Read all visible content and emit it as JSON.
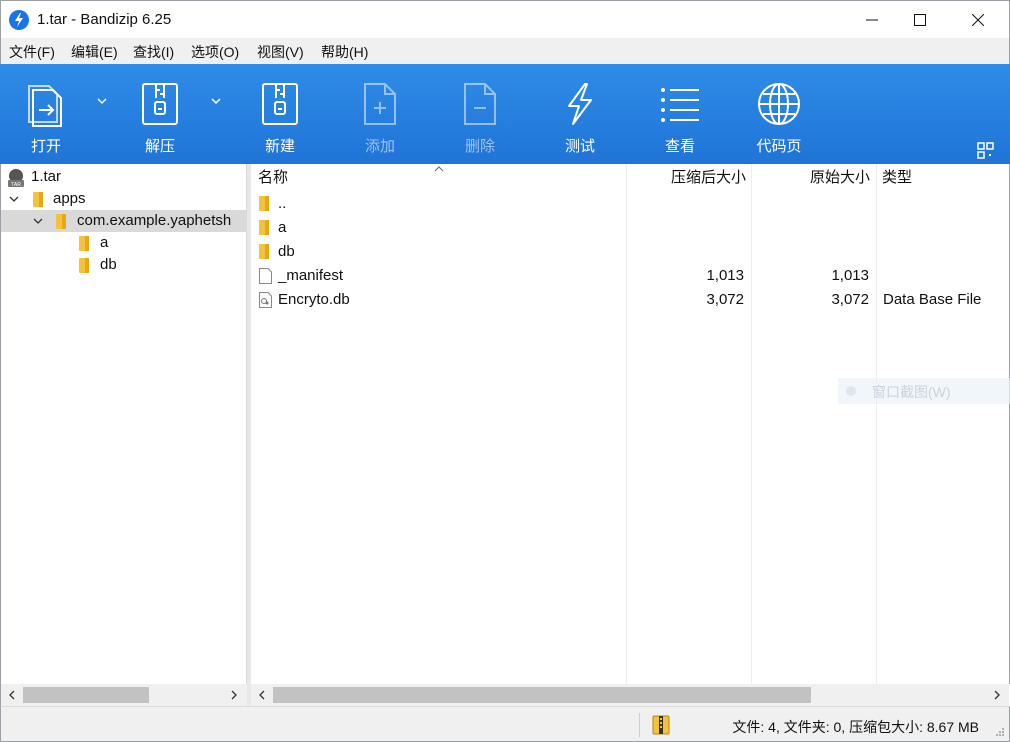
{
  "window": {
    "title": "1.tar - Bandizip 6.25",
    "app_icon": "bandizip-bolt-icon",
    "accent": "#1f74d6"
  },
  "menu": [
    "文件(F)",
    "编辑(E)",
    "查找(I)",
    "选项(O)",
    "视图(V)",
    "帮助(H)"
  ],
  "toolbar": {
    "open": "打开",
    "extract": "解压",
    "new": "新建",
    "add": "添加",
    "delete": "删除",
    "test": "测试",
    "view": "查看",
    "codepage": "代码页"
  },
  "tree": {
    "root": "1.tar",
    "apps": "apps",
    "package": "com.example.yaphetsh",
    "a": "a",
    "db": "db"
  },
  "columns": {
    "name": "名称",
    "compressed": "压缩后大小",
    "original": "原始大小",
    "type": "类型"
  },
  "files": [
    {
      "name": "..",
      "compressed": "",
      "original": "",
      "type": "",
      "icon": "folder-icon"
    },
    {
      "name": "a",
      "compressed": "",
      "original": "",
      "type": "",
      "icon": "folder-icon"
    },
    {
      "name": "db",
      "compressed": "",
      "original": "",
      "type": "",
      "icon": "folder-icon"
    },
    {
      "name": "_manifest",
      "compressed": "1,013",
      "original": "1,013",
      "type": "",
      "icon": "file-icon"
    },
    {
      "name": "Encryto.db",
      "compressed": "3,072",
      "original": "3,072",
      "type": "Data Base File",
      "icon": "db-file-icon"
    }
  ],
  "overlay": {
    "text": "窗口截图(W)"
  },
  "status": {
    "text": "文件: 4, 文件夹: 0, 压缩包大小: 8.67 MB"
  }
}
